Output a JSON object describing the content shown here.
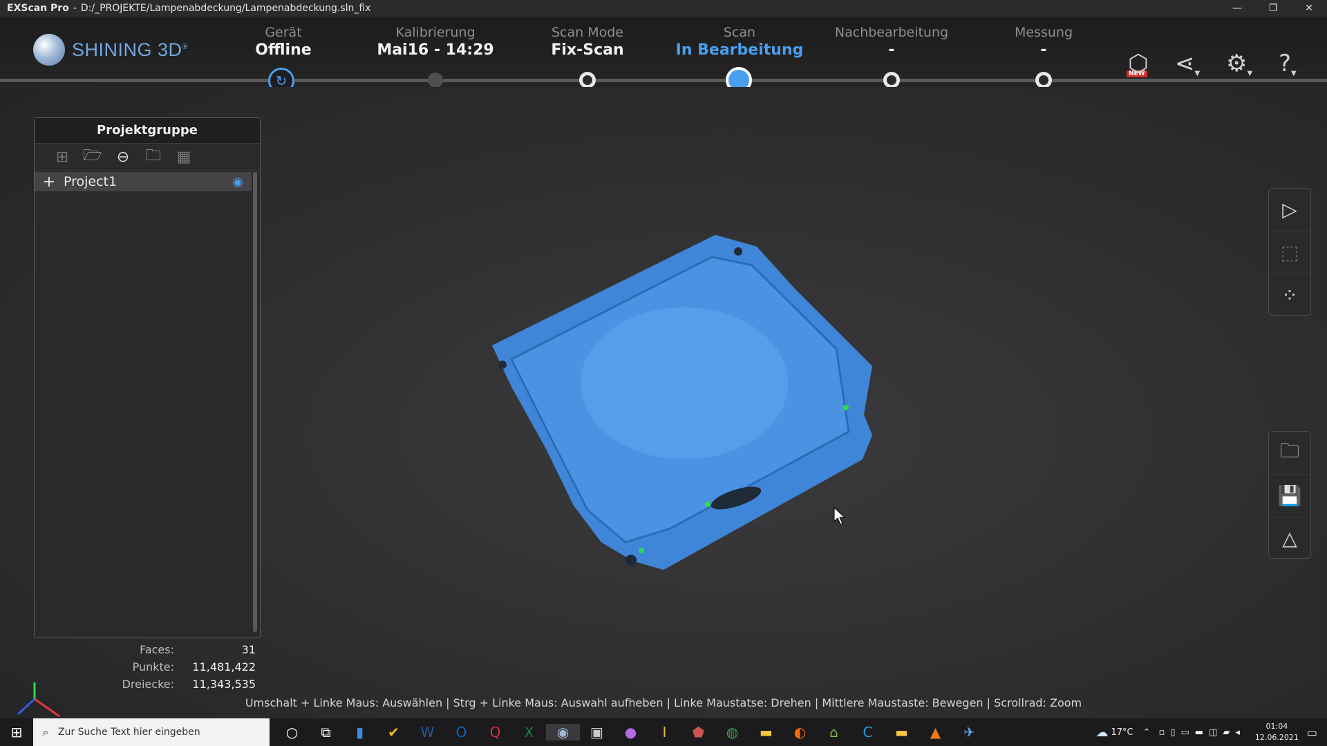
{
  "window": {
    "app": "EXScan Pro",
    "separator": "-",
    "path": "D:/_PROJEKTE/Lampenabdeckung/Lampenabdeckung.sln_fix",
    "controls": [
      "—",
      "❐",
      "✕"
    ]
  },
  "brand": {
    "name": "SHINING 3D",
    "reg": "®"
  },
  "steps": [
    {
      "label": "Gerät",
      "value": "Offline"
    },
    {
      "label": "Kalibrierung",
      "value": "Mai16 - 14:29"
    },
    {
      "label": "Scan Mode",
      "value": "Fix-Scan"
    },
    {
      "label": "Scan",
      "value": "In Bearbeitung"
    },
    {
      "label": "Nachbearbeitung",
      "value": "-"
    },
    {
      "label": "Messung",
      "value": "-"
    }
  ],
  "header_icons": {
    "new_badge": "NEW",
    "model": "cube-new-icon",
    "share": "share-icon",
    "settings": "gear-icon",
    "help": "help-icon"
  },
  "project_panel": {
    "title": "Projektgruppe",
    "tools": [
      "new-group-icon",
      "open-folder-icon",
      "remove-icon",
      "folder-add-icon",
      "grid-icon"
    ],
    "items": [
      {
        "name": "Project1",
        "expand": "+"
      }
    ]
  },
  "stats": {
    "faces_label": "Faces:",
    "faces": "31",
    "points_label": "Punkte:",
    "points": "11,481,422",
    "triangles_label": "Dreiecke:",
    "triangles": "11,343,535"
  },
  "right_tools_top": [
    "play-icon",
    "crop-icon",
    "point-cloud-icon"
  ],
  "right_tools_bottom": [
    "open-folder-icon",
    "save-icon",
    "mesh-icon"
  ],
  "hint": "Umschalt + Linke Maus: Auswählen  | Strg + Linke Maus: Auswahl aufheben | Linke Maustatse: Drehen | Mittlere Maustaste: Bewegen | Scrollrad: Zoom",
  "taskbar": {
    "search_placeholder": "Zur Suche Text hier eingeben",
    "weather": "17°C",
    "time": "01:04",
    "date": "12.06.2021"
  },
  "colors": {
    "accent": "#4a9ff0",
    "mesh": "#3f86d8"
  }
}
